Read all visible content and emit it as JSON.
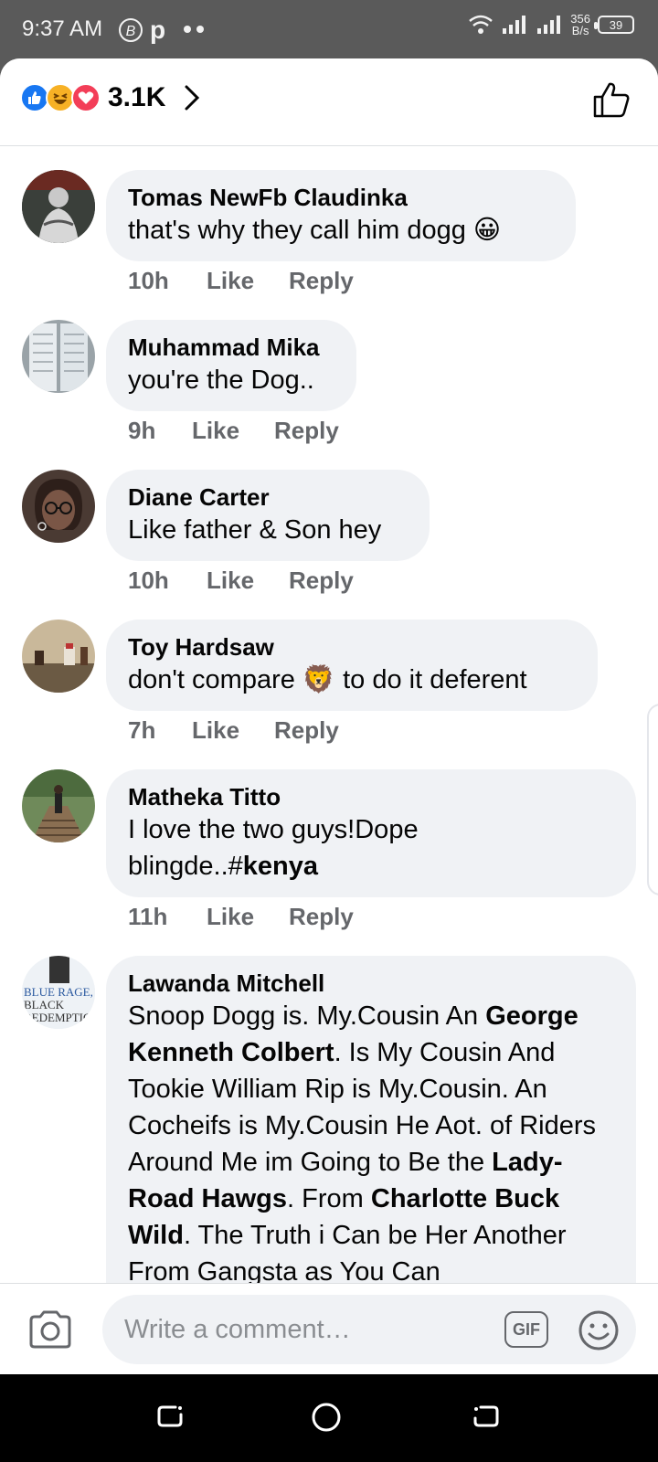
{
  "status_bar": {
    "time": "9:37 AM",
    "net_speed_value": "356",
    "net_speed_unit": "B/s",
    "battery": "39"
  },
  "header": {
    "reaction_count": "3.1K",
    "reactions": [
      "like-icon",
      "haha-icon",
      "love-icon"
    ]
  },
  "comments": [
    {
      "author": "Tomas NewFb Claudinka",
      "text": "that's why they call him dogg 😀",
      "time": "10h",
      "like": "Like",
      "reply": "Reply"
    },
    {
      "author": "Muhammad Mika",
      "text": "you're the Dog..",
      "time": "9h",
      "like": "Like",
      "reply": "Reply"
    },
    {
      "author": "Diane Carter",
      "text": "Like father & Son hey",
      "time": "10h",
      "like": "Like",
      "reply": "Reply"
    },
    {
      "author": "Toy Hardsaw",
      "text": "don't compare 🦁 to do it deferent",
      "time": "7h",
      "like": "Like",
      "reply": "Reply"
    },
    {
      "author": "Matheka Titto",
      "text_parts": [
        "I love the two guys!Dope blingde..#",
        "kenya"
      ],
      "time": "11h",
      "like": "Like",
      "reply": "Reply"
    },
    {
      "author": "Lawanda Mitchell",
      "text_parts": [
        "Snoop Dogg is. My.Cousin An ",
        "George Kenneth Colbert",
        ". Is My Cousin And Tookie William Rip is My.Cousin. An Cocheifs is My.Cousin He Aot. of Riders Around Me im Going to Be the ",
        "Lady-Road Hawgs",
        ". From ",
        "Charlotte Buck Wild",
        ". The Truth i Can be Her Another From Gangsta as You Can"
      ],
      "avatar_text": [
        "BLUE RAGE,",
        "BLACK",
        "REDEMPTION"
      ]
    }
  ],
  "composer": {
    "placeholder": "Write a comment…",
    "gif_label": "GIF"
  },
  "colors": {
    "bubble": "#f0f2f5",
    "meta_text": "#65676b",
    "like_blue": "#1877f2"
  }
}
